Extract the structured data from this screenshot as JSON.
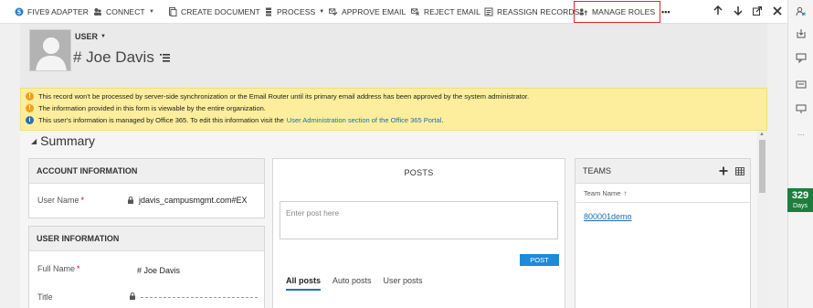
{
  "command_bar": {
    "items": [
      {
        "label": "FIVE9 ADAPTER",
        "icon": "five9-icon"
      },
      {
        "label": "CONNECT",
        "icon": "connect-icon"
      },
      {
        "label": "CREATE DOCUMENT",
        "icon": "document-icon"
      },
      {
        "label": "PROCESS",
        "icon": "process-icon"
      },
      {
        "label": "APPROVE EMAIL",
        "icon": "approve-email-icon"
      },
      {
        "label": "REJECT EMAIL",
        "icon": "reject-email-icon"
      },
      {
        "label": "REASSIGN RECORDS",
        "icon": "reassign-icon"
      },
      {
        "label": "MANAGE ROLES",
        "icon": "manage-roles-icon"
      }
    ],
    "more": "•••",
    "highlight_color": "#e0272d"
  },
  "header": {
    "entity": "USER",
    "record_name": "# Joe Davis"
  },
  "notifications": [
    {
      "type": "warning",
      "text": "This record won't be processed by server-side synchronization or the Email Router until its primary email address has been approved by the system administrator."
    },
    {
      "type": "warning",
      "text": "The information provided in this form is viewable by the entire organization."
    },
    {
      "type": "info",
      "text": "This user's information is managed by Office 365. To edit this information visit the ",
      "link": "User Administration section of the Office 365 Portal",
      "suffix": "."
    }
  ],
  "form": {
    "tab_title": "Summary",
    "account_info": {
      "title": "ACCOUNT INFORMATION",
      "user_name_label": "User Name",
      "user_name_value": "jdavis_campusmgmt.com#EX"
    },
    "user_info": {
      "title": "USER INFORMATION",
      "full_name_label": "Full Name",
      "full_name_value": "# Joe Davis",
      "title_label": "Title"
    },
    "posts": {
      "title": "POSTS",
      "placeholder": "Enter post here",
      "button": "POST",
      "tabs": [
        "All posts",
        "Auto posts",
        "User posts"
      ]
    },
    "teams": {
      "title": "TEAMS",
      "column": "Team Name",
      "rows": [
        "800001demo"
      ]
    }
  },
  "right_rail": {
    "days_count": "329",
    "days_label": "Days",
    "days_color": "#1e7e3e"
  }
}
